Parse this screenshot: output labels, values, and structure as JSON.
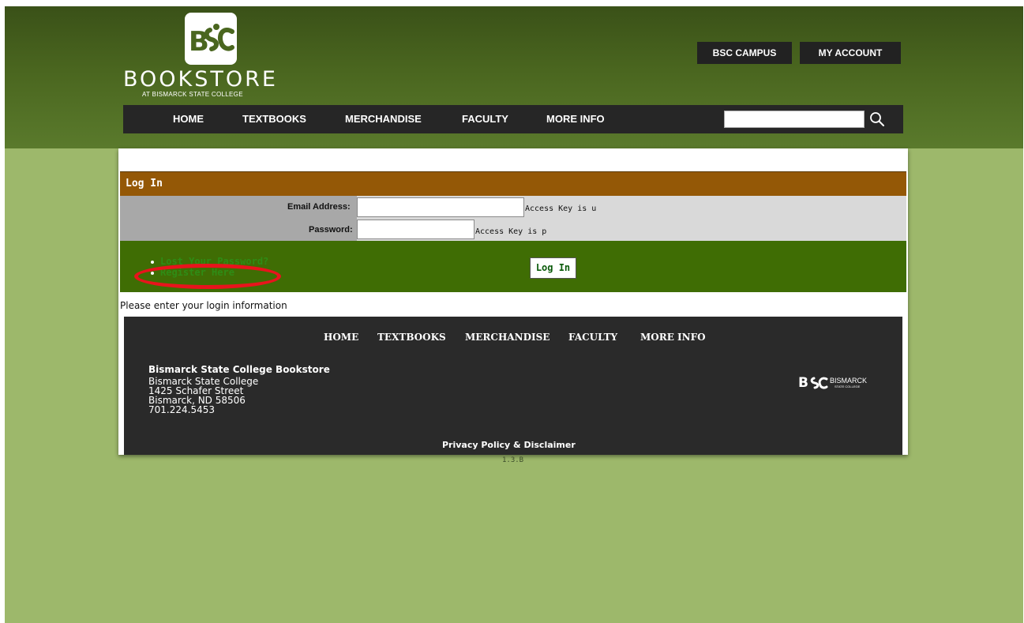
{
  "brand": {
    "logo_mark": "BSC",
    "name": "BOOKSTORE",
    "tagline": "AT BISMARCK STATE COLLEGE"
  },
  "top_links": {
    "campus": "BSC CAMPUS",
    "account": "MY ACCOUNT"
  },
  "nav": [
    "HOME",
    "TEXTBOOKS",
    "MERCHANDISE",
    "FACULTY",
    "MORE INFO"
  ],
  "search": {
    "value": "",
    "icon": "search-icon"
  },
  "login": {
    "title": "Log In",
    "email_label": "Email Address:",
    "email_value": "",
    "email_hint": "Access Key is u",
    "password_label": "Password:",
    "password_value": "",
    "password_hint": "Access Key is p",
    "lost_password": "Lost Your Password?",
    "register": "Register Here",
    "button": "Log In",
    "message": "Please enter your login information"
  },
  "footer": {
    "nav": [
      "HOME",
      "TEXTBOOKS",
      "MERCHANDISE",
      "FACULTY",
      "MORE INFO"
    ],
    "org": "Bismarck State College Bookstore",
    "address": [
      "Bismarck State College",
      "1425 Schafer Street",
      "Bismarck, ND 58506",
      "701.224.5453"
    ],
    "logo_text": "BISMARCK",
    "logo_sub": "STATE COLLEGE",
    "privacy": "Privacy Policy & Disclaimer",
    "version": "1.3.B"
  },
  "colors": {
    "page_bg": "#9db86b",
    "header": "#4a661f",
    "login_bar": "#945806",
    "green_bar": "#3f6d04",
    "footer": "#2a2a2a",
    "annotation": "#e8141c"
  }
}
